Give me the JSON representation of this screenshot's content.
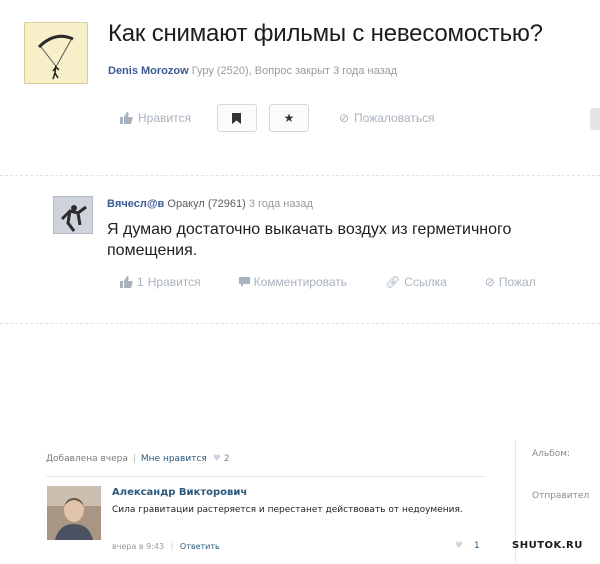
{
  "question": {
    "title": "Как снимают фильмы с невесомостью?",
    "author": "Denis Morozow",
    "meta": "Гуру (2520), Вопрос закрыт 3 года назад",
    "actions": {
      "like_label": "Нравится",
      "bookmark_icon": "bookmark-icon",
      "star_icon": "star-icon",
      "report_label": "Пожаловаться"
    }
  },
  "answer": {
    "author": "Вячесл@в",
    "rank": "Оракул (72961)",
    "time": "3 года назад",
    "text": "Я думаю достаточно выкачать воздух из герметичного помещения.",
    "actions": {
      "likes_count": "1",
      "like_label": "Нравится",
      "comment_label": "Комментировать",
      "link_label": "Ссылка",
      "report_label": "Пожал"
    }
  },
  "vk": {
    "added": "Добавлена вчера",
    "like_text": "Мне нравится",
    "like_count": "2",
    "album_label": "Альбом:",
    "sender_label": "Отправител",
    "comment": {
      "author": "Александр Викторович",
      "text": "Сила гравитации растеряется и перестанет действовать от недоумения.",
      "time": "вчера в 9:43",
      "reply_label": "Ответить",
      "likes": "1"
    }
  },
  "watermark": "SHUTOK.RU",
  "colors": {
    "link_blue": "#3b5a94",
    "vk_blue": "#2b587a",
    "action_gray": "#a9b3bf"
  }
}
